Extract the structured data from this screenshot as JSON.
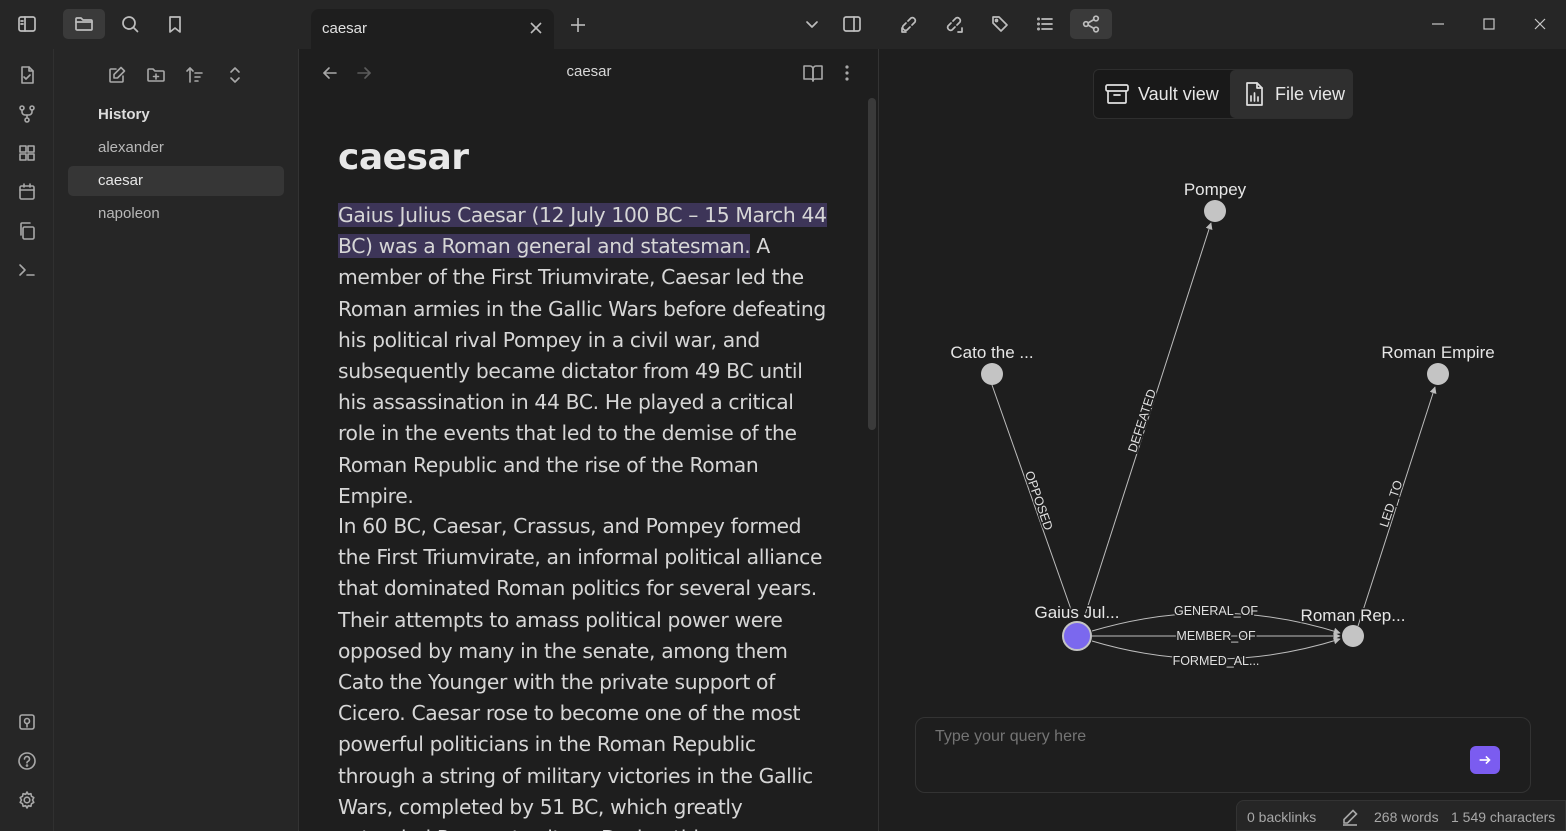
{
  "tab": {
    "title": "caesar"
  },
  "explorer": {
    "folder": "History",
    "files": [
      {
        "label": "alexander"
      },
      {
        "label": "caesar"
      },
      {
        "label": "napoleon"
      }
    ]
  },
  "editor": {
    "header_title": "caesar",
    "heading": "caesar",
    "paragraphs": [
      {
        "highlighted": "Gaius Julius Caesar (12 July 100 BC – 15 March 44 BC) was a Roman general and statesman.",
        "rest": " A member of the First Triumvirate, Caesar led the Roman armies in the Gallic Wars before defeating his political rival Pompey in a civil war, and subsequently became dictator from 49 BC until his assassination in 44 BC. He played a critical role in the events that led to the demise of the Roman Republic and the rise of the Roman Empire."
      },
      {
        "text": "In 60 BC, Caesar, Crassus, and Pompey formed the First Triumvirate, an informal political alliance that dominated Roman politics for several years. Their attempts to amass political power were opposed by many in the senate, among them Cato the Younger with the private support of Cicero. Caesar rose to become one of the most powerful politicians in the Roman Republic through a string of military victories in the Gallic Wars, completed by 51 BC, which greatly extended Roman territory. During this"
      }
    ]
  },
  "graph": {
    "vault_view": "Vault view",
    "file_view": "File view",
    "nodes": {
      "pompey": "Pompey",
      "cato": "Cato the ...",
      "roman_empire": "Roman Empire",
      "gaius": "Gaius Jul...",
      "roman_republic": "Roman Rep..."
    },
    "edges": {
      "defeated": "DEFEATED",
      "opposed": "OPPOSED",
      "led_to": "LED_TO",
      "general_of": "GENERAL_OF",
      "member_of": "MEMBER_OF",
      "formed": "FORMED_AL..."
    },
    "colors": {
      "focus_node": "#7b68ee",
      "node": "#c4c4c4"
    }
  },
  "query": {
    "placeholder": "Type your query here"
  },
  "status": {
    "backlinks": "0 backlinks",
    "words": "268 words",
    "characters": "1 549 characters"
  }
}
